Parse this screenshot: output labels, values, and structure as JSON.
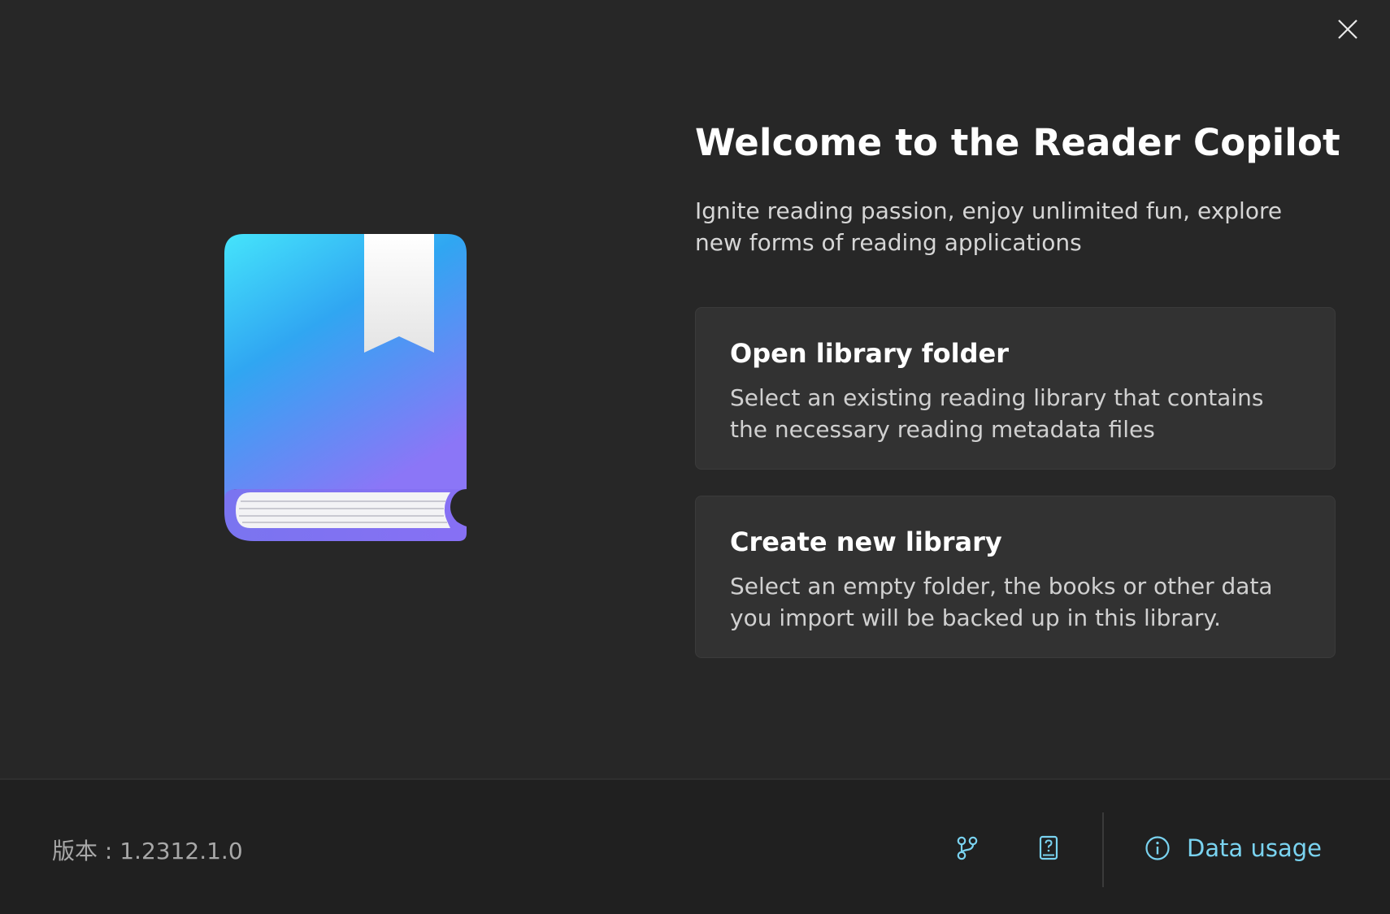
{
  "dialog": {
    "close_icon": "close-icon"
  },
  "hero": {
    "title": "Welcome to the Reader Copilot",
    "subtitle": "Ignite reading passion, enjoy unlimited fun, explore new forms of reading applications",
    "illustration_icon": "book-bookmark-icon"
  },
  "cards": [
    {
      "title": "Open library folder",
      "description": "Select an existing reading library that contains the necessary reading metadata files"
    },
    {
      "title": "Create new library",
      "description": "Select an empty folder, the books or other data you import will be backed up in this library."
    }
  ],
  "footer": {
    "version_text": "版本 : 1.2312.1.0",
    "branch_icon": "branch-icon",
    "help_icon": "help-book-icon",
    "data_usage_icon": "info-icon",
    "data_usage_label": "Data usage"
  },
  "colors": {
    "background": "#272727",
    "footer_background": "#202020",
    "card_background": "#323232",
    "accent": "#7ad3f0",
    "book_gradient_top": "#45e4fb",
    "book_gradient_mid": "#30a6f2",
    "book_gradient_bottom": "#8b76f7"
  }
}
